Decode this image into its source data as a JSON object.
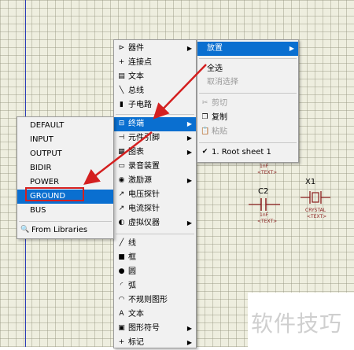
{
  "menu_main": {
    "items": [
      {
        "icon": "component-icon",
        "glyph": "⊳",
        "label": "器件",
        "arrow": "▶"
      },
      {
        "icon": "junction-icon",
        "glyph": "+",
        "label": "连接点",
        "arrow": ""
      },
      {
        "icon": "text-icon",
        "glyph": "▤",
        "label": "文本",
        "arrow": ""
      },
      {
        "icon": "bus-icon",
        "glyph": "╲",
        "label": "总线",
        "arrow": ""
      },
      {
        "icon": "subcircuit-icon",
        "glyph": "▮",
        "label": "子电路",
        "arrow": ""
      },
      {
        "icon": "terminal-icon",
        "glyph": "⊟",
        "label": "终端",
        "arrow": "▶"
      },
      {
        "icon": "device-pin-icon",
        "glyph": "⊣",
        "label": "元件引脚",
        "arrow": "▶"
      },
      {
        "icon": "graph-icon",
        "glyph": "▦",
        "label": "图表",
        "arrow": "▶"
      },
      {
        "icon": "tape-icon",
        "glyph": "▭",
        "label": "录音装置",
        "arrow": ""
      },
      {
        "icon": "generator-icon",
        "glyph": "◉",
        "label": "激励源",
        "arrow": "▶"
      },
      {
        "icon": "voltage-probe-icon",
        "glyph": "↗",
        "label": "电压探针",
        "arrow": ""
      },
      {
        "icon": "current-probe-icon",
        "glyph": "↗",
        "label": "电流探针",
        "arrow": ""
      },
      {
        "icon": "virtual-instrument-icon",
        "glyph": "◐",
        "label": "虚拟仪器",
        "arrow": "▶"
      },
      {
        "icon": "line-icon",
        "glyph": "╱",
        "label": "线",
        "arrow": ""
      },
      {
        "icon": "box-icon",
        "glyph": "■",
        "label": "框",
        "arrow": ""
      },
      {
        "icon": "circle-icon",
        "glyph": "●",
        "label": "圆",
        "arrow": ""
      },
      {
        "icon": "arc-icon",
        "glyph": "◜",
        "label": "弧",
        "arrow": ""
      },
      {
        "icon": "path-icon",
        "glyph": "◠",
        "label": "不规则图形",
        "arrow": ""
      },
      {
        "icon": "text-a-icon",
        "glyph": "A",
        "label": "文本",
        "arrow": ""
      },
      {
        "icon": "symbol-icon",
        "glyph": "▣",
        "label": "图形符号",
        "arrow": "▶"
      },
      {
        "icon": "marker-icon",
        "glyph": "+",
        "label": "标记",
        "arrow": "▶"
      }
    ]
  },
  "menu_context": {
    "place": "放置",
    "select_all": "全选",
    "deselect": "取消选择",
    "cut": "剪切",
    "copy": "复制",
    "paste": "粘贴",
    "root_sheet": "1. Root sheet 1"
  },
  "menu_terminals": {
    "items": [
      "DEFAULT",
      "INPUT",
      "OUTPUT",
      "BIDIR",
      "POWER",
      "GROUND",
      "BUS"
    ],
    "from_libraries": "From Libraries"
  },
  "canvas": {
    "c_cap_value_top": "1nF",
    "c2_ref": "C2",
    "c2_value": "1nF",
    "c2_text": "<TEXT>",
    "x1_ref": "X1",
    "x1_value": "CRYSTAL",
    "x1_text": "<TEXT>",
    "c_top_text": "<TEXT>"
  },
  "watermark": "软件技巧",
  "colors": {
    "selection": "#0a6fd0",
    "highlight_box": "#d42020",
    "arrow": "#d42020"
  }
}
